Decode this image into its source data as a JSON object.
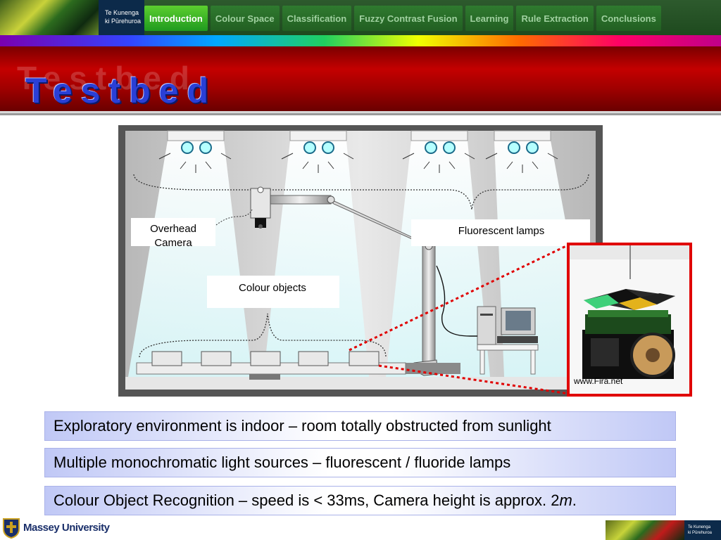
{
  "header": {
    "logo_text_line1": "Te Kunenga",
    "logo_text_line2": "ki Pūrehuroa",
    "tabs": [
      {
        "label": "Introduction",
        "active": true
      },
      {
        "label": "Colour Space",
        "active": false
      },
      {
        "label": "Classification",
        "active": false
      },
      {
        "label": "Fuzzy Contrast Fusion",
        "active": false
      },
      {
        "label": "Learning",
        "active": false
      },
      {
        "label": "Rule Extraction",
        "active": false
      },
      {
        "label": "Conclusions",
        "active": false
      }
    ]
  },
  "slide": {
    "title": "Testbed"
  },
  "diagram": {
    "overhead_camera_label_line1": "Overhead",
    "overhead_camera_label_line2": "Camera",
    "fluorescent_lamps_label": "Fluorescent lamps",
    "colour_objects_label": "Colour objects",
    "photo_credit": "www.Fira.net"
  },
  "bullets": [
    "Exploratory environment is indoor – room totally obstructed from sunlight",
    "Multiple monochromatic light sources – fluorescent / fluoride lamps",
    {
      "text_before": "Colour Object Recognition – speed is < 33ms, Camera height is approx. 2",
      "italic": "m",
      "text_after": "."
    }
  ],
  "footer": {
    "university_name": "Massey University",
    "logo_text_line1": "Te Kunenga",
    "logo_text_line2": "ki Pūrehuroa"
  },
  "colors": {
    "title_band": "#b00000",
    "title_text": "#2a3fd6",
    "nav_active": "#3fb42a",
    "photo_border": "#e00000",
    "bullet_tint": "#c0c8f6"
  }
}
